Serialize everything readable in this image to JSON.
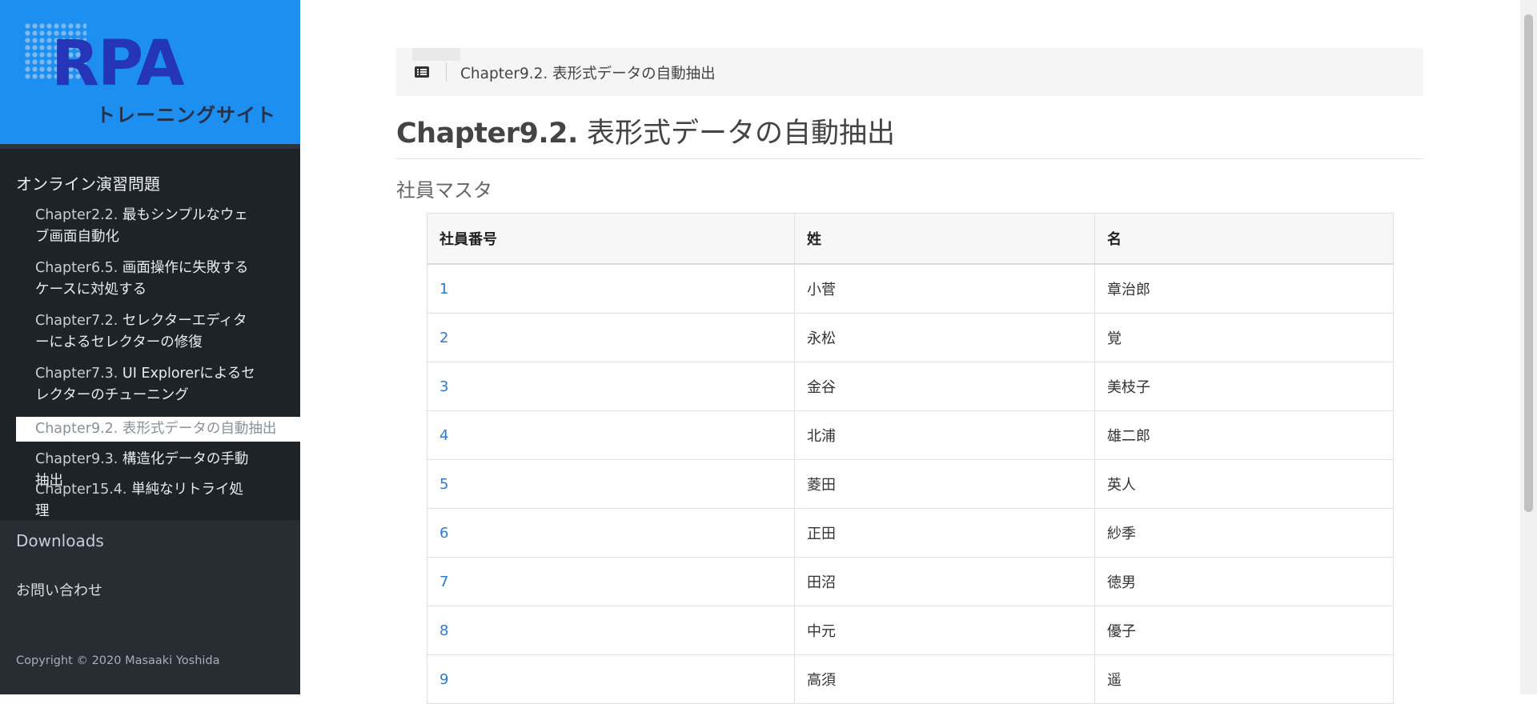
{
  "logo": {
    "title": "RPA",
    "subtitle": "トレーニングサイト"
  },
  "sidebar": {
    "section_title": "オンライン演習問題",
    "items": [
      {
        "num": "Chapter2.2.",
        "label": " 最もシンプルなウェブ画面自動化"
      },
      {
        "num": "Chapter6.5.",
        "label": " 画面操作に失敗するケースに対処する"
      },
      {
        "num": "Chapter7.2.",
        "label": " セレクターエディターによるセレクターの修復"
      },
      {
        "num": "Chapter7.3.",
        "label": " UI Explorerによるセレクターのチューニング"
      },
      {
        "num": "Chapter9.2.",
        "label": " 表形式データの自動抽出"
      },
      {
        "num": "Chapter9.3.",
        "label": " 構造化データの手動抽出"
      },
      {
        "num": "Chapter15.4.",
        "label": " 単純なリトライ処理"
      }
    ],
    "active_index": 4,
    "downloads": "Downloads",
    "contact": "お問い合わせ",
    "copyright": "Copyright © 2020 Masaaki Yoshida"
  },
  "breadcrumb": {
    "icon": "list-icon",
    "text": "Chapter9.2. 表形式データの自動抽出"
  },
  "page": {
    "title_prefix": "Chapter9.2.",
    "title_rest": " 表形式データの自動抽出",
    "section_title": "社員マスタ"
  },
  "table": {
    "headers": [
      "社員番号",
      "姓",
      "名"
    ],
    "rows": [
      [
        "1",
        "小菅",
        "章治郎"
      ],
      [
        "2",
        "永松",
        "覚"
      ],
      [
        "3",
        "金谷",
        "美枝子"
      ],
      [
        "4",
        "北浦",
        "雄二郎"
      ],
      [
        "5",
        "菱田",
        "英人"
      ],
      [
        "6",
        "正田",
        "紗季"
      ],
      [
        "7",
        "田沼",
        "徳男"
      ],
      [
        "8",
        "中元",
        "優子"
      ],
      [
        "9",
        "高須",
        "遥"
      ]
    ]
  },
  "colors": {
    "sidebar_bg": "#1e2328",
    "logo_bg": "#1d8ff0",
    "link": "#2a7ad6"
  }
}
